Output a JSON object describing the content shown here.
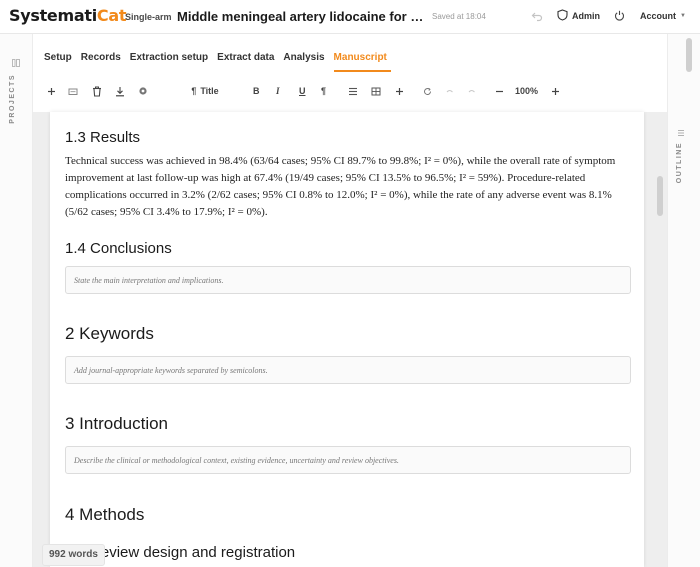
{
  "header": {
    "logo_part1": "Systemati",
    "logo_part2": "Cat",
    "badge": "Single-arm",
    "title": "Middle meningeal artery lidocaine for headach...",
    "saved": "Saved at 18:04",
    "admin_label": "Admin",
    "account_label": "Account"
  },
  "left_rail": {
    "label": "PROJECTS"
  },
  "right_rail": {
    "label": "OUTLINE"
  },
  "tabs": [
    {
      "label": "Setup"
    },
    {
      "label": "Records"
    },
    {
      "label": "Extraction setup"
    },
    {
      "label": "Extract data"
    },
    {
      "label": "Analysis"
    },
    {
      "label": "Manuscript",
      "active": true
    }
  ],
  "toolbar": {
    "style_label": "Title",
    "zoom": "100%"
  },
  "document": {
    "results_heading": "1.3 Results",
    "results_text": "Technical success was achieved in 98.4% (63/64 cases; 95% CI 89.7% to 99.8%; I² = 0%), while the overall rate of symptom improvement at last follow-up was high at 67.4% (19/49 cases; 95% CI 13.5% to 96.5%; I² = 59%). Procedure-related complications occurred in 3.2% (2/62 cases; 95% CI 0.8% to 12.0%; I² = 0%), while the rate of any adverse event was 8.1% (5/62 cases; 95% CI 3.4% to 17.9%; I² = 0%).",
    "conclusions_heading": "1.4 Conclusions",
    "conclusions_placeholder": "State the main interpretation and implications.",
    "keywords_heading": "2 Keywords",
    "keywords_placeholder": "Add journal-appropriate keywords separated by semicolons.",
    "introduction_heading": "3 Introduction",
    "introduction_placeholder": "Describe the clinical or methodological context, existing evidence, uncertainty and review objectives.",
    "methods_heading": "4 Methods",
    "review_design_heading": "4.1 Review design and registration"
  },
  "word_count": "992 words",
  "colors": {
    "accent": "#f28a1c",
    "text": "#1b1b1b"
  }
}
